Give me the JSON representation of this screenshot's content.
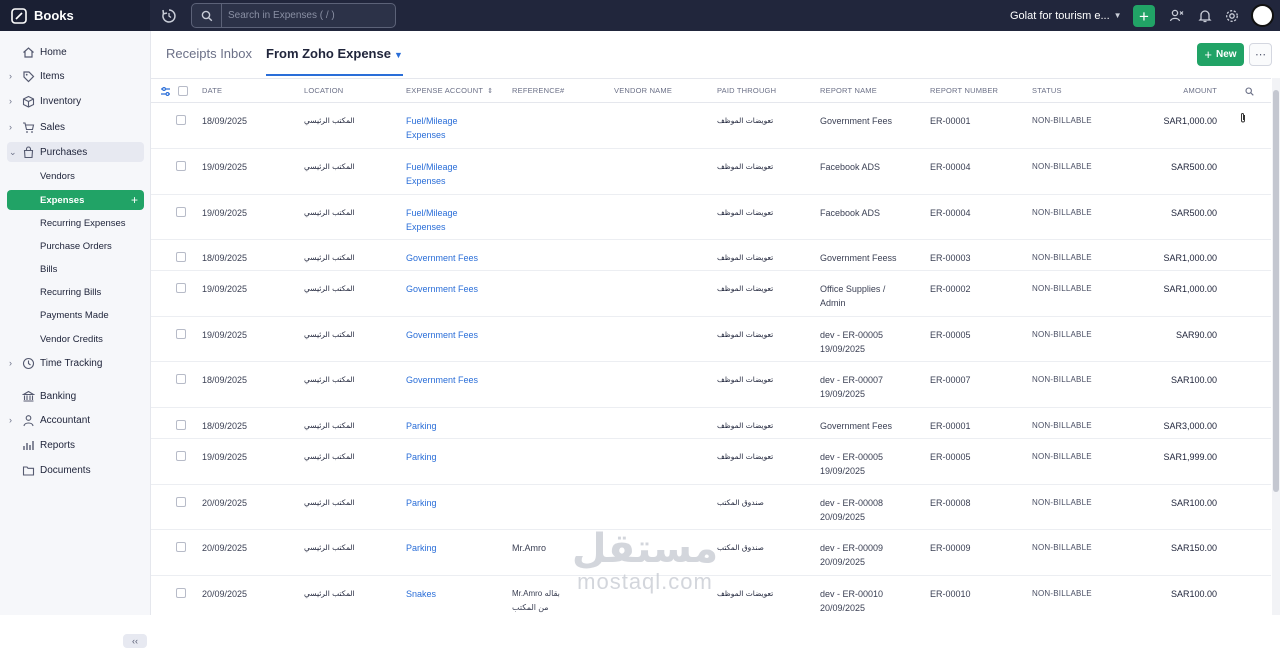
{
  "app": {
    "name": "Books"
  },
  "search": {
    "placeholder": "Search in Expenses ( / )"
  },
  "org": {
    "name": "Golat for tourism e..."
  },
  "sidebar": {
    "items": [
      {
        "label": "Home"
      },
      {
        "label": "Items"
      },
      {
        "label": "Inventory"
      },
      {
        "label": "Sales"
      },
      {
        "label": "Purchases"
      },
      {
        "label": "Time Tracking"
      },
      {
        "label": "Banking"
      },
      {
        "label": "Accountant"
      },
      {
        "label": "Reports"
      },
      {
        "label": "Documents"
      }
    ],
    "purchases_sub": [
      {
        "label": "Vendors"
      },
      {
        "label": "Expenses"
      },
      {
        "label": "Recurring Expenses"
      },
      {
        "label": "Purchase Orders"
      },
      {
        "label": "Bills"
      },
      {
        "label": "Recurring Bills"
      },
      {
        "label": "Payments Made"
      },
      {
        "label": "Vendor Credits"
      }
    ]
  },
  "header": {
    "tabs": [
      {
        "label": "Receipts Inbox"
      },
      {
        "label": "From Zoho Expense"
      }
    ],
    "new_label": "New",
    "more_label": "⋯"
  },
  "table": {
    "columns": [
      "DATE",
      "LOCATION",
      "EXPENSE ACCOUNT",
      "REFERENCE#",
      "VENDOR NAME",
      "PAID THROUGH",
      "REPORT NAME",
      "REPORT NUMBER",
      "STATUS",
      "AMOUNT"
    ],
    "rows": [
      {
        "date": "18/09/2025",
        "location": "المكتب الرئيسي",
        "account": "Fuel/Mileage Expenses",
        "reference": "",
        "vendor": "",
        "paid": "تعويضات الموظف",
        "report_name": "Government Fees",
        "report_number": "ER-00001",
        "status": "NON-BILLABLE",
        "amount": "SAR1,000.00",
        "attachment": true
      },
      {
        "date": "19/09/2025",
        "location": "المكتب الرئيسي",
        "account": "Fuel/Mileage Expenses",
        "reference": "",
        "vendor": "",
        "paid": "تعويضات الموظف",
        "report_name": "Facebook ADS",
        "report_number": "ER-00004",
        "status": "NON-BILLABLE",
        "amount": "SAR500.00"
      },
      {
        "date": "19/09/2025",
        "location": "المكتب الرئيسي",
        "account": "Fuel/Mileage Expenses",
        "reference": "",
        "vendor": "",
        "paid": "تعويضات الموظف",
        "report_name": "Facebook ADS",
        "report_number": "ER-00004",
        "status": "NON-BILLABLE",
        "amount": "SAR500.00"
      },
      {
        "date": "18/09/2025",
        "location": "المكتب الرئيسي",
        "account": "Government Fees",
        "reference": "",
        "vendor": "",
        "paid": "تعويضات الموظف",
        "report_name": "Government Feess",
        "report_number": "ER-00003",
        "status": "NON-BILLABLE",
        "amount": "SAR1,000.00"
      },
      {
        "date": "19/09/2025",
        "location": "المكتب الرئيسي",
        "account": "Government Fees",
        "reference": "",
        "vendor": "",
        "paid": "تعويضات الموظف",
        "report_name": "Office Supplies / Admin",
        "report_number": "ER-00002",
        "status": "NON-BILLABLE",
        "amount": "SAR1,000.00"
      },
      {
        "date": "19/09/2025",
        "location": "المكتب الرئيسي",
        "account": "Government Fees",
        "reference": "",
        "vendor": "",
        "paid": "تعويضات الموظف",
        "report_name": "dev - ER-00005 19/09/2025",
        "report_number": "ER-00005",
        "status": "NON-BILLABLE",
        "amount": "SAR90.00"
      },
      {
        "date": "18/09/2025",
        "location": "المكتب الرئيسي",
        "account": "Government Fees",
        "reference": "",
        "vendor": "",
        "paid": "تعويضات الموظف",
        "report_name": "dev - ER-00007 19/09/2025",
        "report_number": "ER-00007",
        "status": "NON-BILLABLE",
        "amount": "SAR100.00"
      },
      {
        "date": "18/09/2025",
        "location": "المكتب الرئيسي",
        "account": "Parking",
        "reference": "",
        "vendor": "",
        "paid": "تعويضات الموظف",
        "report_name": "Government Fees",
        "report_number": "ER-00001",
        "status": "NON-BILLABLE",
        "amount": "SAR3,000.00"
      },
      {
        "date": "19/09/2025",
        "location": "المكتب الرئيسي",
        "account": "Parking",
        "reference": "",
        "vendor": "",
        "paid": "تعويضات الموظف",
        "report_name": "dev - ER-00005 19/09/2025",
        "report_number": "ER-00005",
        "status": "NON-BILLABLE",
        "amount": "SAR1,999.00"
      },
      {
        "date": "20/09/2025",
        "location": "المكتب الرئيسي",
        "account": "Parking",
        "reference": "",
        "vendor": "",
        "paid": "صندوق المكتب",
        "report_name": "dev - ER-00008 20/09/2025",
        "report_number": "ER-00008",
        "status": "NON-BILLABLE",
        "amount": "SAR100.00"
      },
      {
        "date": "20/09/2025",
        "location": "المكتب الرئيسي",
        "account": "Parking",
        "reference": "Mr.Amro",
        "vendor": "",
        "paid": "صندوق المكتب",
        "report_name": "dev - ER-00009 20/09/2025",
        "report_number": "ER-00009",
        "status": "NON-BILLABLE",
        "amount": "SAR150.00"
      },
      {
        "date": "20/09/2025",
        "location": "المكتب الرئيسي",
        "account": "Snakes",
        "reference": "Mr.Amro بقاله من المكتب",
        "vendor": "",
        "paid": "تعويضات الموظف",
        "report_name": "dev - ER-00010 20/09/2025",
        "report_number": "ER-00010",
        "status": "NON-BILLABLE",
        "amount": "SAR100.00"
      }
    ]
  },
  "watermark": {
    "line1": "مستقل",
    "line2": "mostaql.com"
  }
}
